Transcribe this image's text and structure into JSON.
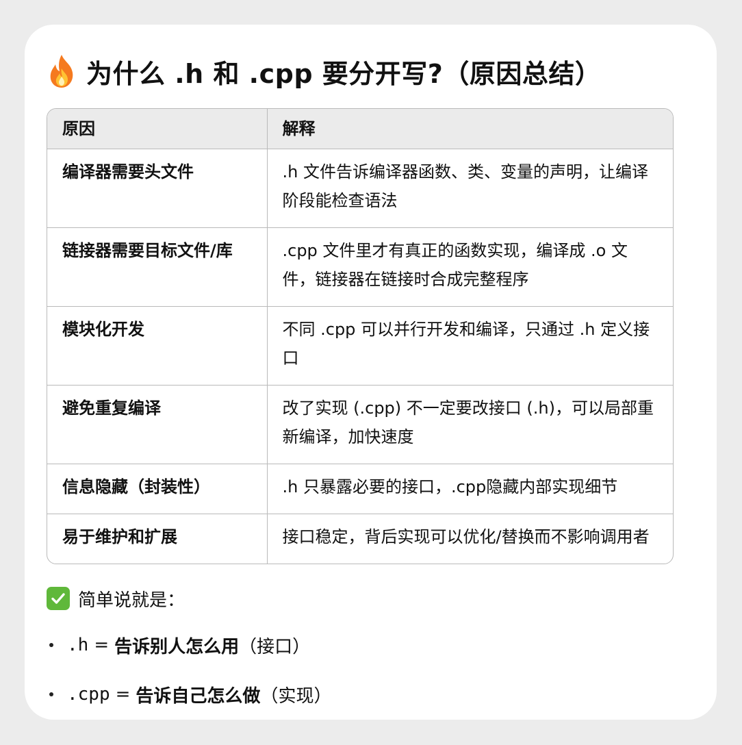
{
  "title": "为什么 .h 和 .cpp 要分开写?（原因总结）",
  "title_icon": "fire-icon",
  "table": {
    "headers": [
      "原因",
      "解释"
    ],
    "rows": [
      {
        "reason": "编译器需要头文件",
        "explanation": ".h 文件告诉编译器函数、类、变量的声明，让编译阶段能检查语法"
      },
      {
        "reason": "链接器需要目标文件/库",
        "explanation": ".cpp 文件里才有真正的函数实现，编译成 .o 文件，链接器在链接时合成完整程序"
      },
      {
        "reason": "模块化开发",
        "explanation": "不同 .cpp 可以并行开发和编译，只通过 .h 定义接口"
      },
      {
        "reason": "避免重复编译",
        "explanation": "改了实现 (.cpp) 不一定要改接口 (.h)，可以局部重新编译，加快速度"
      },
      {
        "reason": "信息隐藏（封装性）",
        "explanation": ".h 只暴露必要的接口，.cpp隐藏内部实现细节"
      },
      {
        "reason": "易于维护和扩展",
        "explanation": "接口稳定，背后实现可以优化/替换而不影响调用者"
      }
    ]
  },
  "summary": {
    "icon": "check-mark-icon",
    "text": "简单说就是："
  },
  "bullets": [
    {
      "key": ".h",
      "eq": "=",
      "desc": "告诉别人怎么用",
      "note": "（接口）"
    },
    {
      "key": ".cpp",
      "eq": "=",
      "desc": "告诉自己怎么做",
      "note": "（实现）"
    }
  ],
  "colors": {
    "header_bg": "#ebebeb",
    "border": "#b9b9b9",
    "check_green": "#5fb83a",
    "fire_orange": "#f57a1f"
  }
}
